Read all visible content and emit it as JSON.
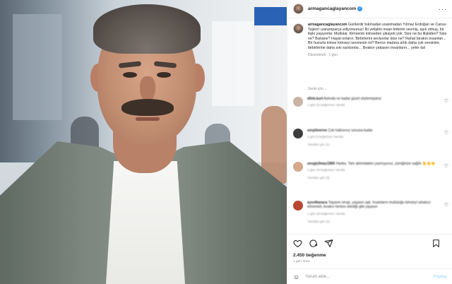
{
  "post": {
    "username": "armagancaglayancom",
    "caption": "Günlerdir bıkmadan usanmadan Yılmaz Erdoğan ve Cansu Taşkın'ı paramparça ediyorsunuz! İki yetişkin insan birbirini sevmiş, aşık olmuş, bir ilişki yaşıyorlar. Mutlular. Kimsenin kimseden şikayeti yok. Size ne bu ilişkiden? Size ne? Banane? Hayat onların. Birbirlerini seviyorlar bize ne? Rahat bırakın insanları... Bir huzurla kimse kimseyi sevmesin mi? Bence inadına artık daha çok sevsinler, birbirlerine daha sıkı sarılsınlar... Bırakın yakasını insanların... yeter da!",
    "caption_time": "Düzenlendi · 1 gün",
    "sort_label": "Senin için",
    "likes": "2.450 beğenme",
    "time_ago": "1 gün önce",
    "add_comment_placeholder": "Yorum ekle...",
    "post_button": "Paylaş"
  },
  "comments": [
    {
      "user": "dilek.kurt",
      "text": "Aslında ne kadar güzel söylemişsiniz",
      "meta": "1 gün   15 beğenme   Yanıtla",
      "avatar_color": "#c9b4a5"
    },
    {
      "user": "serpilmerve",
      "text": "Çok haklısınız sonuna kadar",
      "meta": "1 gün   5 beğenme   Yanıtla",
      "avatar_color": "#3d3d3d",
      "replies": "Yanıtları gör (1)"
    },
    {
      "user": "sevgiyilmaz1965",
      "text": "Harika. Tam aklımdakini yazmışsınız, yüreğinize sağlık 👏👏👏",
      "meta": "1 gün   29 beğenme   Yanıtla",
      "avatar_color": "#d6a98c",
      "replies": "Yanıtları gör (3)"
    },
    {
      "user": "ayselkaraca",
      "text": "Yaşasın sevgi, yaşasın aşk. İnsanların mutluluğu kimseyi rahatsız etmemeli, bırakın herkes istediği gibi yaşasın",
      "meta": "1 gün   18 beğenme   Yanıtla",
      "avatar_color": "#b7482f",
      "replies": "Yanıtları gör (2)"
    }
  ],
  "icons": {
    "like": "heart-icon",
    "comment": "comment-icon",
    "share": "share-icon",
    "save": "save-icon"
  }
}
